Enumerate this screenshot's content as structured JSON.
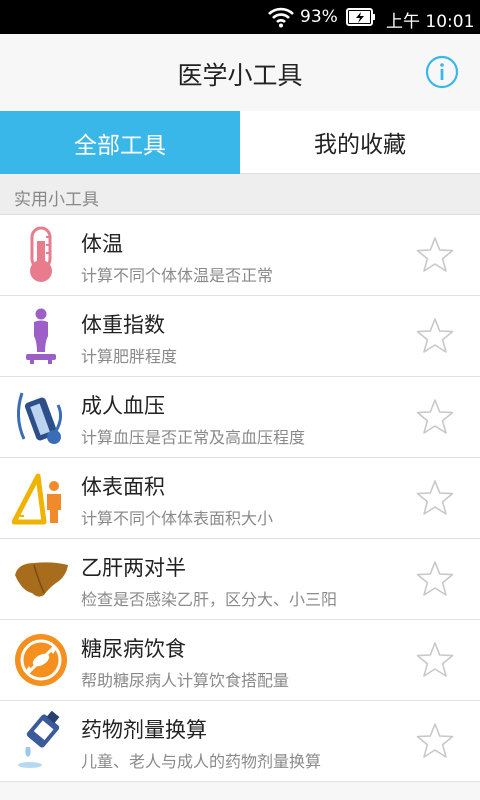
{
  "status_bar": {
    "battery_percent": "93%",
    "time": "上午 10:01",
    "wifi_icon": "wifi-icon",
    "battery_icon": "battery-charging-icon"
  },
  "header": {
    "title": "医学小工具",
    "info_icon": "info-icon"
  },
  "tabs": [
    {
      "label": "全部工具",
      "active": true
    },
    {
      "label": "我的收藏",
      "active": false
    }
  ],
  "section": {
    "title": "实用小工具"
  },
  "tools": [
    {
      "name": "体温",
      "desc": "计算不同个体体温是否正常",
      "icon": "thermometer-icon",
      "favorited": false
    },
    {
      "name": "体重指数",
      "desc": "计算肥胖程度",
      "icon": "person-scale-icon",
      "favorited": false
    },
    {
      "name": "成人血压",
      "desc": "计算血压是否正常及高血压程度",
      "icon": "blood-pressure-monitor-icon",
      "favorited": false
    },
    {
      "name": "体表面积",
      "desc": "计算不同个体体表面积大小",
      "icon": "ruler-person-icon",
      "favorited": false
    },
    {
      "name": "乙肝两对半",
      "desc": "检查是否感染乙肝，区分大、小三阳",
      "icon": "liver-icon",
      "favorited": false
    },
    {
      "name": "糖尿病饮食",
      "desc": "帮助糖尿病人计算饮食搭配量",
      "icon": "no-candy-icon",
      "favorited": false
    },
    {
      "name": "药物剂量换算",
      "desc": "儿童、老人与成人的药物剂量换算",
      "icon": "medicine-bottle-icon",
      "favorited": false
    }
  ],
  "colors": {
    "accent": "#3ab7e9",
    "star_outline": "#c8c8c8",
    "desc_text": "#8a8a8a"
  }
}
